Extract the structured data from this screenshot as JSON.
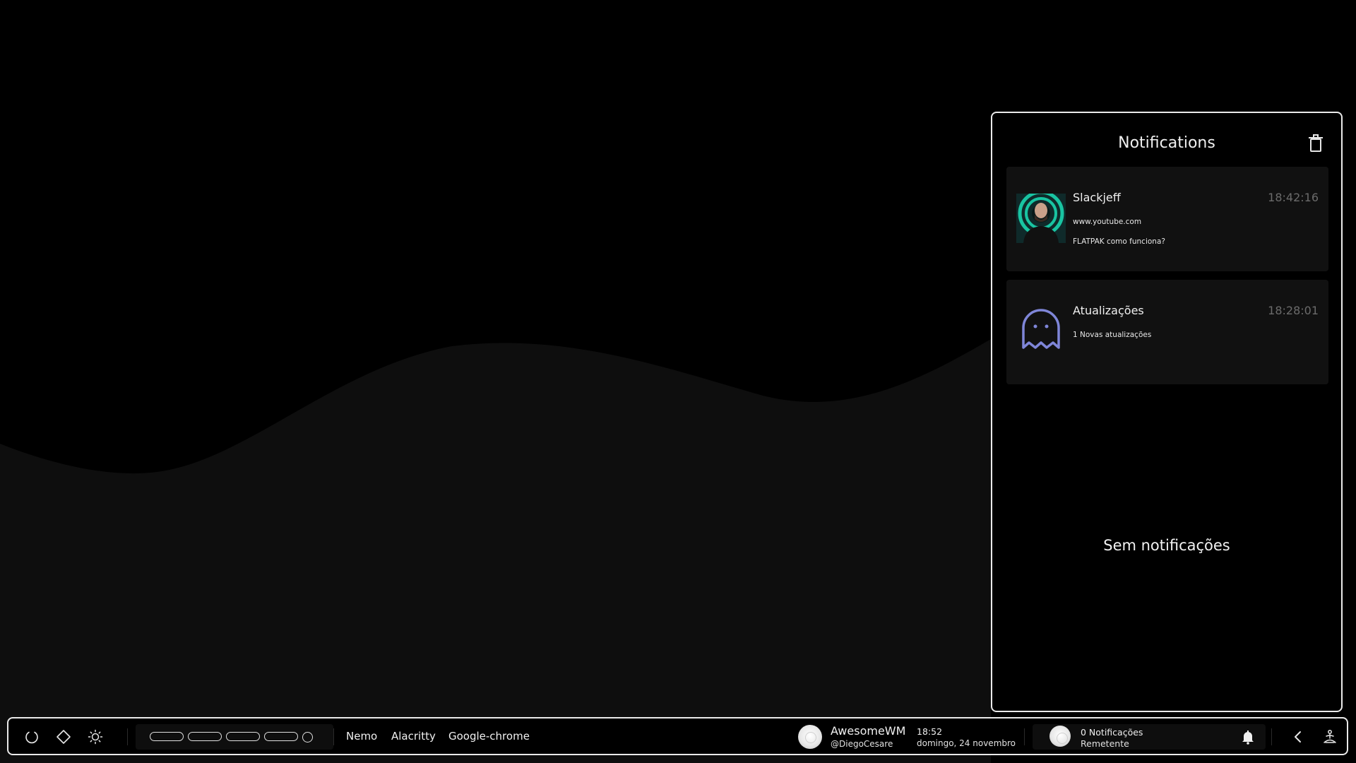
{
  "notification_center": {
    "title": "Notifications",
    "items": [
      {
        "app_name": "Slackjeff",
        "time": "18:42:16",
        "lines": [
          "www.youtube.com",
          "FLATPAK como funciona?"
        ]
      },
      {
        "app_name": "Atualizações",
        "time": "18:28:01",
        "lines": [
          "1 Novas atualizações"
        ]
      }
    ],
    "empty_message": "Sem notificações"
  },
  "taskbar": {
    "tasks": [
      "Nemo",
      "Alacritty",
      "Google-chrome"
    ],
    "user": {
      "name": "AwesomeWM",
      "handle": "@DiegoCesare"
    },
    "clock": {
      "time": "18:52",
      "date": "domingo, 24 novembro"
    },
    "notifications_widget": {
      "count_label": "0 Notificações",
      "sender_label": "Remetente"
    }
  },
  "colors": {
    "background": "#000000",
    "panel_border": "#eaeaea",
    "card_background": "#111111",
    "ghost_icon": "#7f86d8",
    "muted_time": "#6b6b6b"
  }
}
